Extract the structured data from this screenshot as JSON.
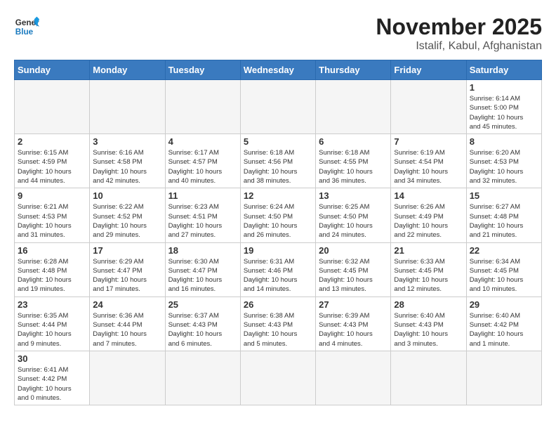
{
  "header": {
    "logo_general": "General",
    "logo_blue": "Blue",
    "title": "November 2025",
    "subtitle": "Istalif, Kabul, Afghanistan"
  },
  "weekdays": [
    "Sunday",
    "Monday",
    "Tuesday",
    "Wednesday",
    "Thursday",
    "Friday",
    "Saturday"
  ],
  "days": [
    {
      "date": "",
      "info": ""
    },
    {
      "date": "",
      "info": ""
    },
    {
      "date": "",
      "info": ""
    },
    {
      "date": "",
      "info": ""
    },
    {
      "date": "",
      "info": ""
    },
    {
      "date": "",
      "info": ""
    },
    {
      "date": "1",
      "info": "Sunrise: 6:14 AM\nSunset: 5:00 PM\nDaylight: 10 hours\nand 45 minutes."
    },
    {
      "date": "2",
      "info": "Sunrise: 6:15 AM\nSunset: 4:59 PM\nDaylight: 10 hours\nand 44 minutes."
    },
    {
      "date": "3",
      "info": "Sunrise: 6:16 AM\nSunset: 4:58 PM\nDaylight: 10 hours\nand 42 minutes."
    },
    {
      "date": "4",
      "info": "Sunrise: 6:17 AM\nSunset: 4:57 PM\nDaylight: 10 hours\nand 40 minutes."
    },
    {
      "date": "5",
      "info": "Sunrise: 6:18 AM\nSunset: 4:56 PM\nDaylight: 10 hours\nand 38 minutes."
    },
    {
      "date": "6",
      "info": "Sunrise: 6:18 AM\nSunset: 4:55 PM\nDaylight: 10 hours\nand 36 minutes."
    },
    {
      "date": "7",
      "info": "Sunrise: 6:19 AM\nSunset: 4:54 PM\nDaylight: 10 hours\nand 34 minutes."
    },
    {
      "date": "8",
      "info": "Sunrise: 6:20 AM\nSunset: 4:53 PM\nDaylight: 10 hours\nand 32 minutes."
    },
    {
      "date": "9",
      "info": "Sunrise: 6:21 AM\nSunset: 4:53 PM\nDaylight: 10 hours\nand 31 minutes."
    },
    {
      "date": "10",
      "info": "Sunrise: 6:22 AM\nSunset: 4:52 PM\nDaylight: 10 hours\nand 29 minutes."
    },
    {
      "date": "11",
      "info": "Sunrise: 6:23 AM\nSunset: 4:51 PM\nDaylight: 10 hours\nand 27 minutes."
    },
    {
      "date": "12",
      "info": "Sunrise: 6:24 AM\nSunset: 4:50 PM\nDaylight: 10 hours\nand 26 minutes."
    },
    {
      "date": "13",
      "info": "Sunrise: 6:25 AM\nSunset: 4:50 PM\nDaylight: 10 hours\nand 24 minutes."
    },
    {
      "date": "14",
      "info": "Sunrise: 6:26 AM\nSunset: 4:49 PM\nDaylight: 10 hours\nand 22 minutes."
    },
    {
      "date": "15",
      "info": "Sunrise: 6:27 AM\nSunset: 4:48 PM\nDaylight: 10 hours\nand 21 minutes."
    },
    {
      "date": "16",
      "info": "Sunrise: 6:28 AM\nSunset: 4:48 PM\nDaylight: 10 hours\nand 19 minutes."
    },
    {
      "date": "17",
      "info": "Sunrise: 6:29 AM\nSunset: 4:47 PM\nDaylight: 10 hours\nand 17 minutes."
    },
    {
      "date": "18",
      "info": "Sunrise: 6:30 AM\nSunset: 4:47 PM\nDaylight: 10 hours\nand 16 minutes."
    },
    {
      "date": "19",
      "info": "Sunrise: 6:31 AM\nSunset: 4:46 PM\nDaylight: 10 hours\nand 14 minutes."
    },
    {
      "date": "20",
      "info": "Sunrise: 6:32 AM\nSunset: 4:45 PM\nDaylight: 10 hours\nand 13 minutes."
    },
    {
      "date": "21",
      "info": "Sunrise: 6:33 AM\nSunset: 4:45 PM\nDaylight: 10 hours\nand 12 minutes."
    },
    {
      "date": "22",
      "info": "Sunrise: 6:34 AM\nSunset: 4:45 PM\nDaylight: 10 hours\nand 10 minutes."
    },
    {
      "date": "23",
      "info": "Sunrise: 6:35 AM\nSunset: 4:44 PM\nDaylight: 10 hours\nand 9 minutes."
    },
    {
      "date": "24",
      "info": "Sunrise: 6:36 AM\nSunset: 4:44 PM\nDaylight: 10 hours\nand 7 minutes."
    },
    {
      "date": "25",
      "info": "Sunrise: 6:37 AM\nSunset: 4:43 PM\nDaylight: 10 hours\nand 6 minutes."
    },
    {
      "date": "26",
      "info": "Sunrise: 6:38 AM\nSunset: 4:43 PM\nDaylight: 10 hours\nand 5 minutes."
    },
    {
      "date": "27",
      "info": "Sunrise: 6:39 AM\nSunset: 4:43 PM\nDaylight: 10 hours\nand 4 minutes."
    },
    {
      "date": "28",
      "info": "Sunrise: 6:40 AM\nSunset: 4:43 PM\nDaylight: 10 hours\nand 3 minutes."
    },
    {
      "date": "29",
      "info": "Sunrise: 6:40 AM\nSunset: 4:42 PM\nDaylight: 10 hours\nand 1 minute."
    },
    {
      "date": "30",
      "info": "Sunrise: 6:41 AM\nSunset: 4:42 PM\nDaylight: 10 hours\nand 0 minutes."
    },
    {
      "date": "",
      "info": ""
    },
    {
      "date": "",
      "info": ""
    },
    {
      "date": "",
      "info": ""
    },
    {
      "date": "",
      "info": ""
    },
    {
      "date": "",
      "info": ""
    },
    {
      "date": "",
      "info": ""
    }
  ]
}
